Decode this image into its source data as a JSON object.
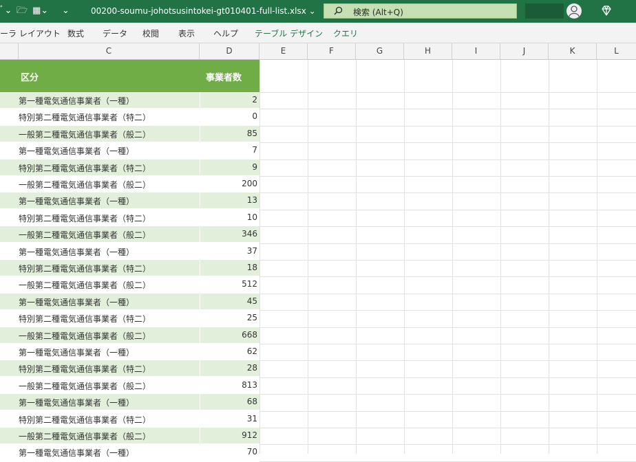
{
  "titlebar": {
    "filename": "00200-soumu-johotsusintokei-gt010401-full-list.xlsx",
    "search_text": "検索 (Alt+Q)",
    "accent": "#217346"
  },
  "ribbon": {
    "tabs": [
      "ーラ レイアウト",
      "数式",
      "データ",
      "校閲",
      "表示",
      "ヘルプ"
    ],
    "context_tabs": [
      "テーブル デザイン",
      "クエリ"
    ]
  },
  "columns": [
    "C",
    "D",
    "E",
    "F",
    "G",
    "H",
    "I",
    "J",
    "K",
    "L"
  ],
  "table": {
    "headers": [
      "区分",
      "事業者数"
    ],
    "rows": [
      [
        "第一種電気通信事業者（一種）",
        "2"
      ],
      [
        "特別第二種電気通信事業者（特二）",
        "0"
      ],
      [
        "一般第二種電気通信事業者（般二）",
        "85"
      ],
      [
        "第一種電気通信事業者（一種）",
        "7"
      ],
      [
        "特別第二種電気通信事業者（特二）",
        "9"
      ],
      [
        "一般第二種電気通信事業者（般二）",
        "200"
      ],
      [
        "第一種電気通信事業者（一種）",
        "13"
      ],
      [
        "特別第二種電気通信事業者（特二）",
        "10"
      ],
      [
        "一般第二種電気通信事業者（般二）",
        "346"
      ],
      [
        "第一種電気通信事業者（一種）",
        "37"
      ],
      [
        "特別第二種電気通信事業者（特二）",
        "18"
      ],
      [
        "一般第二種電気通信事業者（般二）",
        "512"
      ],
      [
        "第一種電気通信事業者（一種）",
        "45"
      ],
      [
        "特別第二種電気通信事業者（特二）",
        "25"
      ],
      [
        "一般第二種電気通信事業者（般二）",
        "668"
      ],
      [
        "第一種電気通信事業者（一種）",
        "62"
      ],
      [
        "特別第二種電気通信事業者（特二）",
        "28"
      ],
      [
        "一般第二種電気通信事業者（般二）",
        "813"
      ],
      [
        "第一種電気通信事業者（一種）",
        "68"
      ],
      [
        "特別第二種電気通信事業者（特二）",
        "31"
      ],
      [
        "一般第二種電気通信事業者（般二）",
        "912"
      ],
      [
        "第一種電気通信事業者（一種）",
        "70"
      ]
    ],
    "header_color": "#70ad47",
    "band_color": "#e2efda"
  }
}
